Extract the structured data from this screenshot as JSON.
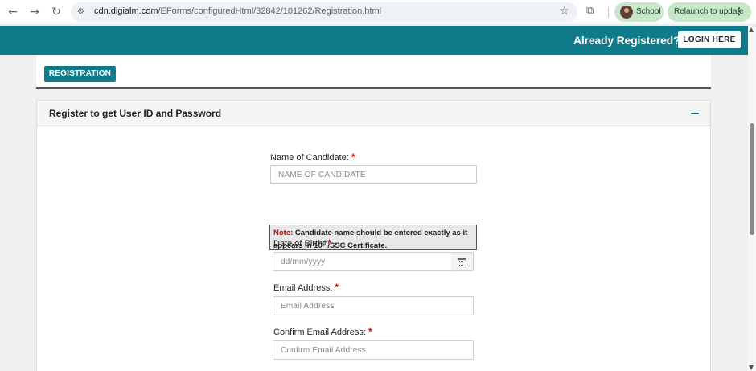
{
  "browser": {
    "back_icon": "back-arrow-icon",
    "forward_icon": "forward-arrow-icon",
    "reload_icon": "reload-icon",
    "url_host": "cdn.digialm.com",
    "url_path": "/EForms/configuredHtml/32842/101262/Registration.html",
    "profile_name": "School",
    "relaunch_label": "Relaunch to update"
  },
  "header": {
    "already_registered": "Already Registered?",
    "login_label": "LOGIN HERE"
  },
  "tabs": {
    "registration": "REGISTRATION"
  },
  "panel": {
    "title": "Register to get User ID and Password"
  },
  "form": {
    "name": {
      "label": "Name of Candidate:",
      "placeholder": "NAME OF CANDIDATE"
    },
    "note": {
      "prefix": "Note:",
      "text_1": " Candidate name should be entered exactly as it appears in 10",
      "sup": "th",
      "text_2": "/SSC Certificate."
    },
    "dob": {
      "label": "Date of Birth:",
      "placeholder": "dd/mm/yyyy"
    },
    "email": {
      "label": "Email Address:",
      "placeholder": "Email Address"
    },
    "confirm_email": {
      "label": "Confirm Email Address:",
      "placeholder": "Confirm Email Address"
    },
    "required_mark": "*"
  },
  "colors": {
    "brand": "#0f7a8a",
    "required": "#e00000"
  }
}
